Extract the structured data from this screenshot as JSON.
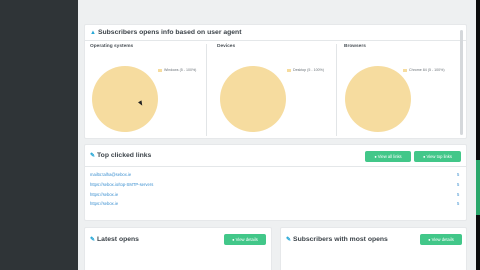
{
  "user_agent_panel": {
    "title": "Subscribers opens info based on user agent",
    "columns": [
      {
        "title": "Operating systems",
        "legend": "Windows (5 - 100%)"
      },
      {
        "title": "Devices",
        "legend": "Desktop (5 - 100%)"
      },
      {
        "title": "Browsers",
        "legend": "Chrome 84 (5 - 100%)"
      }
    ]
  },
  "chart_data": [
    {
      "type": "pie",
      "title": "Operating systems",
      "categories": [
        "Windows"
      ],
      "values": [
        5
      ],
      "percent": [
        100
      ],
      "colors": [
        "#f6dc9f"
      ]
    },
    {
      "type": "pie",
      "title": "Devices",
      "categories": [
        "Desktop"
      ],
      "values": [
        5
      ],
      "percent": [
        100
      ],
      "colors": [
        "#f6dc9f"
      ]
    },
    {
      "type": "pie",
      "title": "Browsers",
      "categories": [
        "Chrome 84"
      ],
      "values": [
        5
      ],
      "percent": [
        100
      ],
      "colors": [
        "#f6dc9f"
      ]
    }
  ],
  "top_links_panel": {
    "title": "Top clicked links",
    "view_all_label": "View all links",
    "view_top_label": "View top links",
    "links": [
      {
        "url": "mailto:talha@sebox.ie",
        "count": "5"
      },
      {
        "url": "https://sebox.io/top-SMTP-servers",
        "count": "5"
      },
      {
        "url": "https://sebox.ie",
        "count": "5"
      },
      {
        "url": "https://sebox.ie",
        "count": "5"
      }
    ]
  },
  "latest_opens_panel": {
    "title": "Latest opens",
    "button_label": "View details"
  },
  "most_opens_panel": {
    "title": "Subscribers with most opens",
    "button_label": "View details"
  },
  "colors": {
    "accent_green": "#42c789",
    "pie_fill": "#f6dc9f",
    "link_blue": "#3a8fd0",
    "icon_blue": "#29a8d6"
  }
}
